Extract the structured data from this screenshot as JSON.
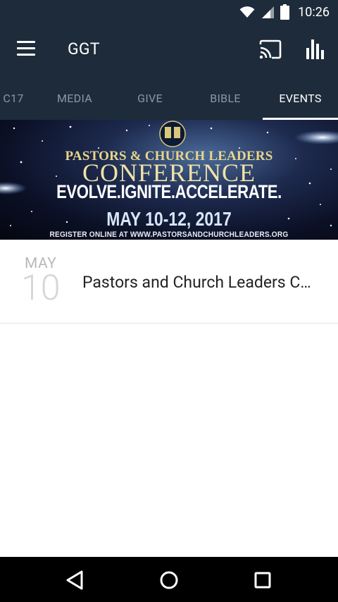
{
  "status_bar": {
    "time": "10:26",
    "icons": [
      "wifi-icon",
      "cell-signal-icon",
      "battery-icon"
    ]
  },
  "app_bar": {
    "title": "GGT",
    "icons": [
      "menu-icon",
      "cast-icon",
      "bar-chart-icon"
    ]
  },
  "tabs": [
    {
      "label": "C17",
      "active": false
    },
    {
      "label": "MEDIA",
      "active": false
    },
    {
      "label": "GIVE",
      "active": false
    },
    {
      "label": "BIBLE",
      "active": false
    },
    {
      "label": "EVENTS",
      "active": true
    }
  ],
  "banner": {
    "line1": "PASTORS & CHURCH LEADERS",
    "line2": "CONFERENCE",
    "line3": "EVOLVE.IGNITE.ACCELERATE.",
    "date": "MAY 10-12, 2017",
    "register": "REGISTER ONLINE AT WWW.PASTORSANDCHURCHLEADERS.ORG"
  },
  "events": [
    {
      "month": "MAY",
      "day": "10",
      "title": "Pastors and Church Leaders C…"
    }
  ],
  "nav_bar": {
    "icons": [
      "back-icon",
      "home-icon",
      "recents-icon"
    ]
  },
  "colors": {
    "app_bar_bg": "#1e2b3a",
    "tab_inactive": "#8d97a3",
    "tab_active": "#ffffff"
  }
}
